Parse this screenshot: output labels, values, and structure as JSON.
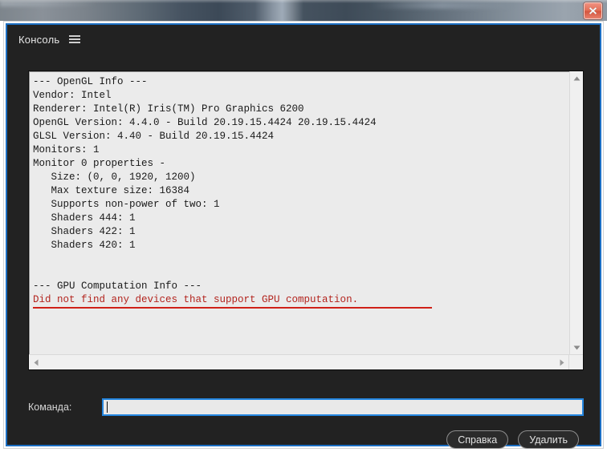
{
  "window": {
    "title": "Консоль",
    "menu_icon": "hamburger-menu-icon",
    "close_icon": "close-icon",
    "accent_color": "#1b6ec2",
    "body_color": "#222222"
  },
  "console": {
    "background_color": "#ebebeb",
    "text_color": "#1a1a1a",
    "error_color": "#b3241e",
    "lines": [
      {
        "text": "--- OpenGL Info ---",
        "kind": "normal"
      },
      {
        "text": "Vendor: Intel",
        "kind": "normal"
      },
      {
        "text": "Renderer: Intel(R) Iris(TM) Pro Graphics 6200",
        "kind": "normal"
      },
      {
        "text": "OpenGL Version: 4.4.0 - Build 20.19.15.4424 20.19.15.4424",
        "kind": "normal"
      },
      {
        "text": "GLSL Version: 4.40 - Build 20.19.15.4424",
        "kind": "normal"
      },
      {
        "text": "Monitors: 1",
        "kind": "normal"
      },
      {
        "text": "Monitor 0 properties -",
        "kind": "normal"
      },
      {
        "text": "   Size: (0, 0, 1920, 1200)",
        "kind": "normal"
      },
      {
        "text": "   Max texture size: 16384",
        "kind": "normal"
      },
      {
        "text": "   Supports non-power of two: 1",
        "kind": "normal"
      },
      {
        "text": "   Shaders 444: 1",
        "kind": "normal"
      },
      {
        "text": "   Shaders 422: 1",
        "kind": "normal"
      },
      {
        "text": "   Shaders 420: 1",
        "kind": "normal"
      },
      {
        "text": "",
        "kind": "blank"
      },
      {
        "text": "",
        "kind": "blank"
      },
      {
        "text": "--- GPU Computation Info ---",
        "kind": "normal"
      },
      {
        "text": "Did not find any devices that support GPU computation.",
        "kind": "error"
      }
    ],
    "scrollbars": {
      "vertical": {
        "up_icon": "scroll-up-arrow-icon",
        "down_icon": "scroll-down-arrow-icon"
      },
      "horizontal": {
        "left_icon": "scroll-left-arrow-icon",
        "right_icon": "scroll-right-arrow-icon"
      }
    }
  },
  "command": {
    "label": "Команда:",
    "value": "",
    "placeholder": ""
  },
  "buttons": {
    "help": "Справка",
    "delete": "Удалить"
  }
}
